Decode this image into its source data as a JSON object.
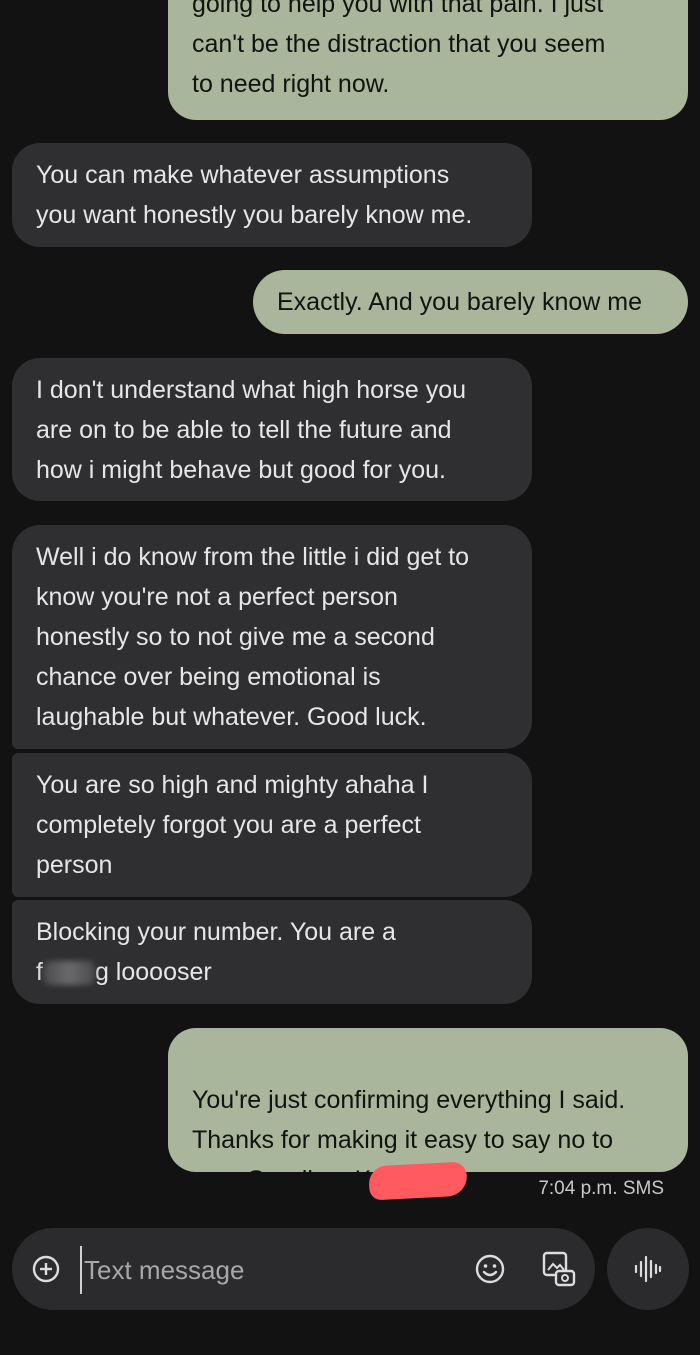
{
  "messages": [
    {
      "id": "m1",
      "dir": "out",
      "text": "going to help you with that pain. I just\ncan't be the distraction that you seem\nto need right now."
    },
    {
      "id": "m2",
      "dir": "in",
      "text": "You can make whatever assumptions\nyou want honestly you barely know me."
    },
    {
      "id": "m3",
      "dir": "out",
      "text": "Exactly. And you barely know me"
    },
    {
      "id": "m4",
      "dir": "in",
      "text": "I don't understand what high horse you\nare on to be able to tell the future and\nhow i might behave but good for you."
    },
    {
      "id": "m5",
      "dir": "in",
      "text": "Well i do know from the little i did get to\nknow you're not a perfect person\nhonestly so to not give me a second\nchance over being emotional is\nlaughable but whatever. Good luck."
    },
    {
      "id": "m6",
      "dir": "in",
      "text": "You are so high and mighty ahaha I\ncompletely forgot you are a perfect\nperson"
    },
    {
      "id": "m7",
      "dir": "in",
      "line1": "Blocking your number. You are a",
      "pre": "f",
      "post": "g looooser"
    },
    {
      "id": "m8",
      "dir": "out",
      "line12": "You're just confirming everything I said.\nThanks for making it easy to say no to\n",
      "line3": "you. Goodbye K"
    }
  ],
  "meta": {
    "time": "7:04 p.m.",
    "type": "SMS"
  },
  "composer": {
    "placeholder": "Text message"
  },
  "icons": [
    "add-icon",
    "emoji-icon",
    "gallery-icon",
    "voice-icon"
  ],
  "colors": {
    "background": "#121212",
    "outgoing": "#a9b69b",
    "incoming": "#2f2f31",
    "redaction": "#ff5a5f"
  }
}
